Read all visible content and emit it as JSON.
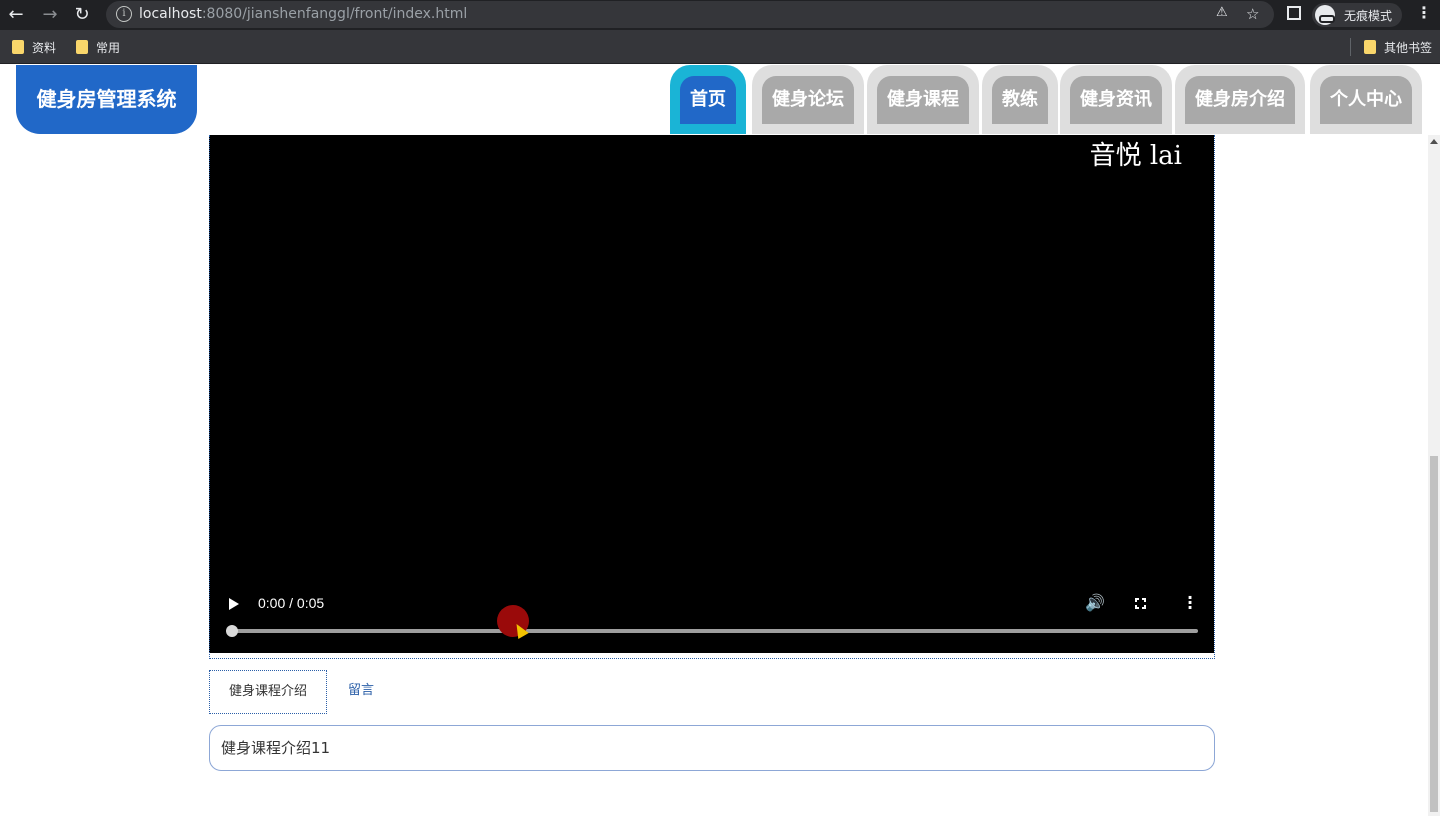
{
  "browser": {
    "url_host": "localhost",
    "url_rest": ":8080/jianshenfanggl/front/index.html",
    "incognito_label": "无痕模式",
    "bookmarks": [
      "资料",
      "常用"
    ],
    "other_bookmarks": "其他书签"
  },
  "site": {
    "logo": "健身房管理系统",
    "menu": [
      "首页",
      "健身论坛",
      "健身课程",
      "教练",
      "健身资讯",
      "健身房介绍",
      "个人中心"
    ],
    "active_menu_index": 0
  },
  "video": {
    "watermark": "音悦 lai",
    "time": "0:00 / 0:05",
    "progress": 0
  },
  "tabs": [
    "健身课程介绍",
    "留言"
  ],
  "content_text": "健身课程介绍11"
}
